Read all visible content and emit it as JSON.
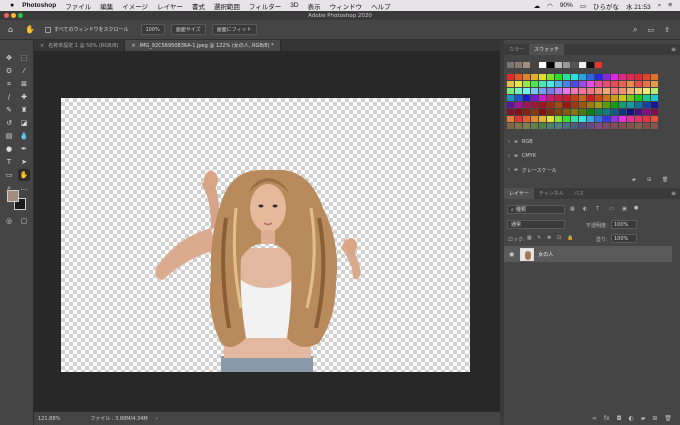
{
  "menubar": {
    "app": "Photoshop",
    "items": [
      "ファイル",
      "編集",
      "イメージ",
      "レイヤー",
      "書式",
      "選択範囲",
      "フィルター",
      "3D",
      "表示",
      "ウィンドウ",
      "ヘルプ"
    ],
    "battery": "90%",
    "ime": "ひらがな",
    "clock": "水 21:53"
  },
  "window": {
    "title": "Adobe Photoshop 2020"
  },
  "options": {
    "scroll_all": "すべてのウィンドウをスクロール",
    "zoom": "100%",
    "fit_screen": "画面サイズ",
    "fill_screen": "画面にフィット"
  },
  "tabs": [
    {
      "label": "名称未設定 1 @ 50% (RGB/8)"
    },
    {
      "label": "IMG_92C56950836A-1.jpeg @ 122% (女の人, RGB/8) *"
    }
  ],
  "status": {
    "zoom": "121.88%",
    "file": "ファイル : 3.88M/4.34M"
  },
  "color_panel": {
    "tab1": "カラー",
    "tab2": "スウォッチ",
    "groups": [
      "RGB",
      "CMYK",
      "グレースケール"
    ]
  },
  "layers_panel": {
    "tab1": "レイヤー",
    "tab2": "チャンネル",
    "tab3": "パス",
    "filter": "種類",
    "blend": "通常",
    "opacity_label": "不透明度:",
    "opacity": "100%",
    "lock_label": "ロック:",
    "fill_label": "塗り:",
    "fill": "100%",
    "layer_name": "女の人"
  },
  "colors": {
    "foreground": "#a68b7f",
    "background": "#1a1a1a"
  },
  "icons": [
    "apple-icon",
    "hand-icon",
    "move-icon",
    "marquee-icon",
    "lasso-icon",
    "wand-icon",
    "crop-icon",
    "frame-icon",
    "eyedropper-icon",
    "healing-icon",
    "brush-icon",
    "stamp-icon",
    "history-brush-icon",
    "eraser-icon",
    "gradient-icon",
    "blur-icon",
    "dodge-icon",
    "pen-icon",
    "type-icon",
    "path-select-icon",
    "shape-icon",
    "zoom-icon",
    "folder-icon",
    "eye-icon",
    "trash-icon",
    "search-icon"
  ]
}
